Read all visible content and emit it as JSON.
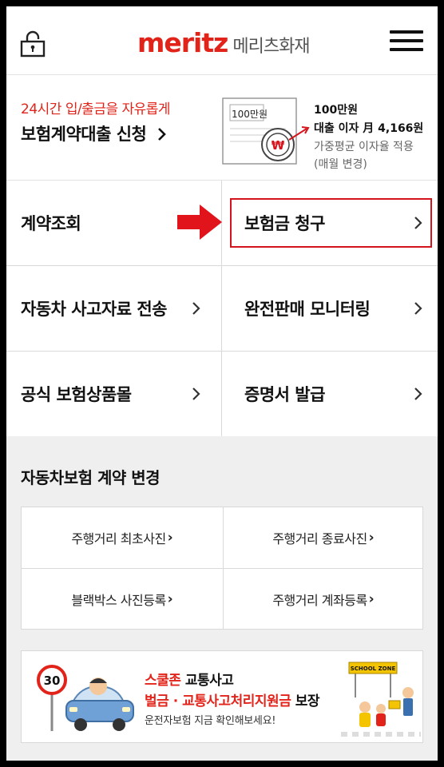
{
  "header": {
    "logo_main": "meritz",
    "logo_sub": "메리츠화재"
  },
  "loan": {
    "subtitle": "24시간 입/출금을 자유롭게",
    "link_label": "보험계약대출 신청",
    "doc_amount": "100만원",
    "rate_line1": "100만원",
    "rate_line2": "대출 이자 月 4,166원",
    "rate_line3": "가중평균 이자율 적용",
    "rate_line4": "(매월 변경)"
  },
  "menu": [
    {
      "label": "계약조회"
    },
    {
      "label": "보험금 청구"
    },
    {
      "label": "자동차 사고자료 전송"
    },
    {
      "label": "완전판매 모니터링"
    },
    {
      "label": "공식 보험상품몰"
    },
    {
      "label": "증명서 발급"
    }
  ],
  "change": {
    "title": "자동차보험 계약 변경",
    "items": [
      {
        "label": "주행거리 최초사진"
      },
      {
        "label": "주행거리 종료사진"
      },
      {
        "label": "블랙박스 사진등록"
      },
      {
        "label": "주행거리 계좌등록"
      }
    ]
  },
  "banner": {
    "line1_red": "스쿨존",
    "line1_rest": " 교통사고",
    "line2_red": "벌금 · 교통사고처리지원금",
    "line2_rest": " 보장",
    "line3": "운전자보험 지금 확인해보세요!",
    "speed_sign": "30",
    "zone_sign": "SCHOOL ZONE"
  },
  "colors": {
    "brand_red": "#e2231a",
    "highlight_red": "#d4141c",
    "section_gray": "#efefef"
  }
}
